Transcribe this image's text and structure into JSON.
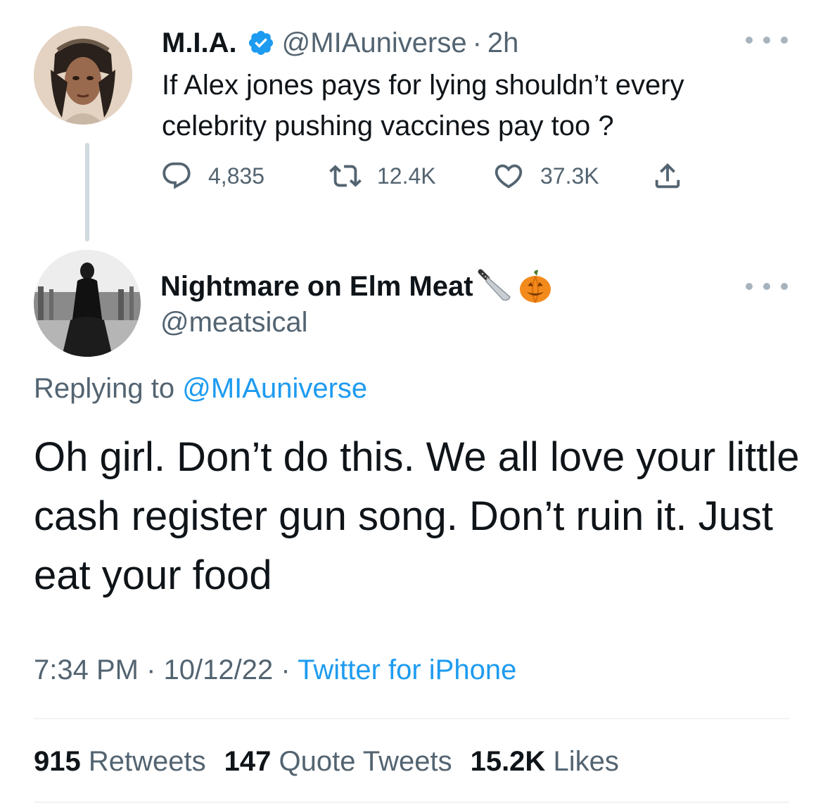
{
  "parent_tweet": {
    "author_name": "M.I.A.",
    "verified": true,
    "handle": "@MIAuniverse",
    "separator": "·",
    "time_ago": "2h",
    "text": "If Alex jones pays for lying shouldn’t every celebrity pushing vaccines pay too ?",
    "actions": {
      "replies": "4,835",
      "retweets": "12.4K",
      "likes": "37.3K"
    },
    "icons": [
      "reply-icon",
      "retweet-icon",
      "like-icon",
      "share-icon",
      "more-icon",
      "verified-badge-icon"
    ]
  },
  "reply_tweet": {
    "author_name": "Nightmare on Elm Meat",
    "name_emojis": [
      "knife",
      "jack-o-lantern"
    ],
    "handle": "@meatsical",
    "replying_prefix": "Replying to",
    "replying_to": "@MIAuniverse",
    "text": "Oh girl. Don’t do this. We all love your little cash register gun song. Don’t ruin it. Just eat your food",
    "time": "7:34 PM",
    "date": "10/12/22",
    "separator": "·",
    "source": "Twitter for iPhone",
    "stats": {
      "retweets_count": "915",
      "retweets_label": "Retweets",
      "quotes_count": "147",
      "quotes_label": "Quote Tweets",
      "likes_count": "15.2K",
      "likes_label": "Likes"
    }
  },
  "colors": {
    "text": "#0f1419",
    "secondary": "#536471",
    "accent": "#1d9bf0",
    "divider": "#eff3f4",
    "thread_line": "#cfd9de"
  }
}
